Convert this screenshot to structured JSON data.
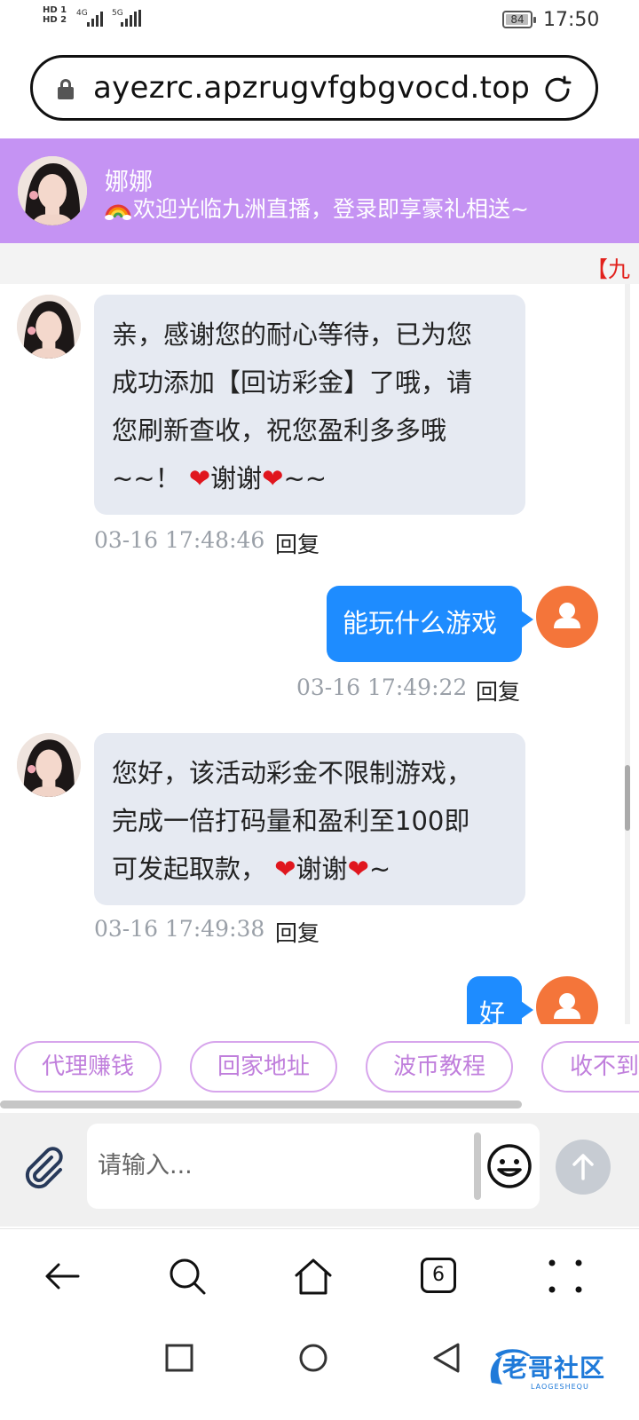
{
  "status_bar": {
    "network": [
      "HD 1",
      "HD 2"
    ],
    "sim1_type": "4G",
    "sim2_type": "5G",
    "battery": "84",
    "time": "17:50"
  },
  "browser": {
    "url": "ayezrc.apzrugvfgbgvocd.top",
    "tab_count": "6"
  },
  "chat": {
    "agent_name": "娜娜",
    "agent_subtitle": "欢迎光临九洲直播，登录即享豪礼相送~",
    "marquee": "【九",
    "reply_label": "回复",
    "messages": [
      {
        "side": "in",
        "lines": [
          "亲，感谢您的耐心等待，已为您",
          "成功添加【回访彩金】了哦，请",
          "您刷新查收，祝您盈利多多哦"
        ],
        "last_prefix": "~~！",
        "last_mid": "谢谢",
        "last_suffix": "~~",
        "time": "03-16 17:48:46"
      },
      {
        "side": "out",
        "text": "能玩什么游戏",
        "time": "03-16 17:49:22"
      },
      {
        "side": "in",
        "lines": [
          "您好，该活动彩金不限制游戏，",
          "完成一倍打码量和盈利至100即"
        ],
        "last_prefix": "可发起取款，",
        "last_mid": "谢谢",
        "last_suffix": "~",
        "time": "03-16 17:49:38"
      },
      {
        "side": "out",
        "text": "好",
        "time": ""
      }
    ]
  },
  "quick_replies": [
    "代理赚钱",
    "回家地址",
    "波币教程",
    "收不到"
  ],
  "composer": {
    "placeholder": "请输入..."
  },
  "watermark": {
    "text": "老哥社区",
    "sub": "LAOGESHEQU"
  },
  "colors": {
    "header": "#c593f3",
    "outgoing": "#1e8cff",
    "incoming": "#e6eaf2",
    "chip": "#d7a5ec"
  }
}
